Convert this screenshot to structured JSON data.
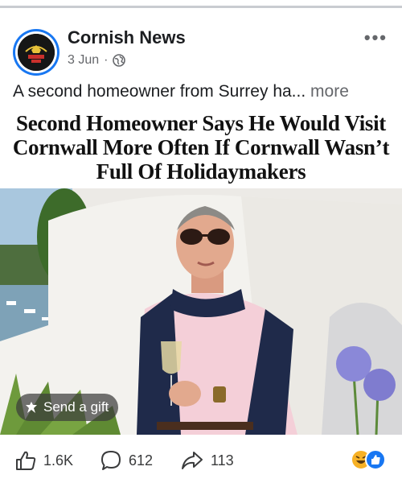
{
  "post": {
    "page_name": "Cornish News",
    "date": "3 Jun",
    "separator": "·",
    "more_menu": "•••",
    "caption_text": "A second homeowner from Surrey ha...",
    "caption_more": "more",
    "headline": "Second Homeowner Says He Would Visit Cornwall More Often If Cornwall Wasn’t Full Of Holidaymakers",
    "icons": {
      "avatar": "cornish-news-logo",
      "audience": "globe-icon",
      "menu": "more-icon",
      "gift": "gift-icon",
      "like": "thumbs-up-icon",
      "comment": "comment-icon",
      "share": "share-icon"
    }
  },
  "gift_button": {
    "label": "Send a gift"
  },
  "actions": {
    "likes": "1.6K",
    "comments": "612",
    "shares": "113"
  },
  "colors": {
    "brand_blue": "#1877f2",
    "reaction_haha": "#f7b125",
    "reaction_like": "#1877f2",
    "text_secondary": "#65676b"
  }
}
